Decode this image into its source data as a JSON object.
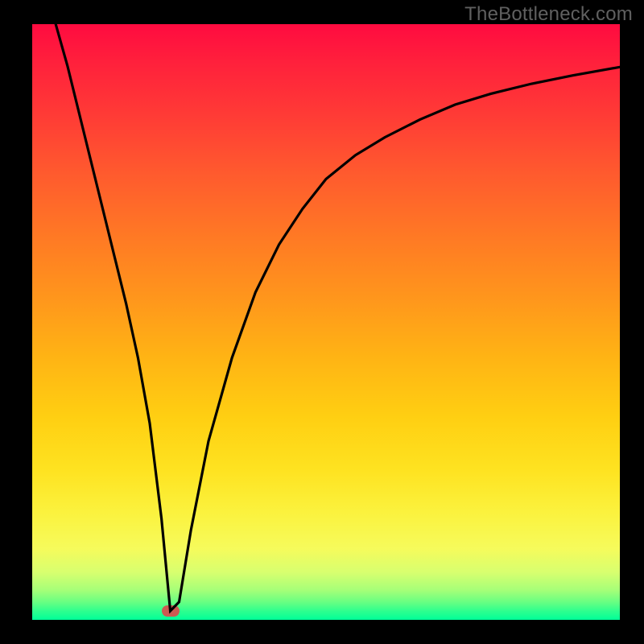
{
  "watermark": "TheBottleneck.com",
  "colors": {
    "frame": "#000000",
    "watermark_text": "#606060",
    "curve": "#000000",
    "marker": "#cc5a52",
    "gradient_top": "#ff0b40",
    "gradient_bottom": "#00ff98"
  },
  "chart_data": {
    "type": "line",
    "title": "",
    "xlabel": "",
    "ylabel": "",
    "xlim": [
      0,
      100
    ],
    "ylim": [
      0,
      100
    ],
    "x": [
      4,
      6,
      8,
      10,
      12,
      14,
      16,
      18,
      20,
      22,
      23.5,
      25,
      27,
      30,
      34,
      38,
      42,
      46,
      50,
      55,
      60,
      66,
      72,
      78,
      85,
      92,
      100
    ],
    "values": [
      100,
      93,
      85,
      77,
      69,
      61,
      53,
      44,
      33,
      17,
      1.5,
      3,
      15,
      30,
      44,
      55,
      63,
      69,
      74,
      78,
      81,
      84,
      86.5,
      88.3,
      90,
      91.4,
      92.8
    ],
    "marker": {
      "x": 23.5,
      "y": 1.5
    },
    "notes": "Background heat gradient runs red (top, high bottleneck %) to green (bottom, 0%). Curve shows bottleneck % vs an unlabeled x-axis; minimum at x≈23.5."
  }
}
